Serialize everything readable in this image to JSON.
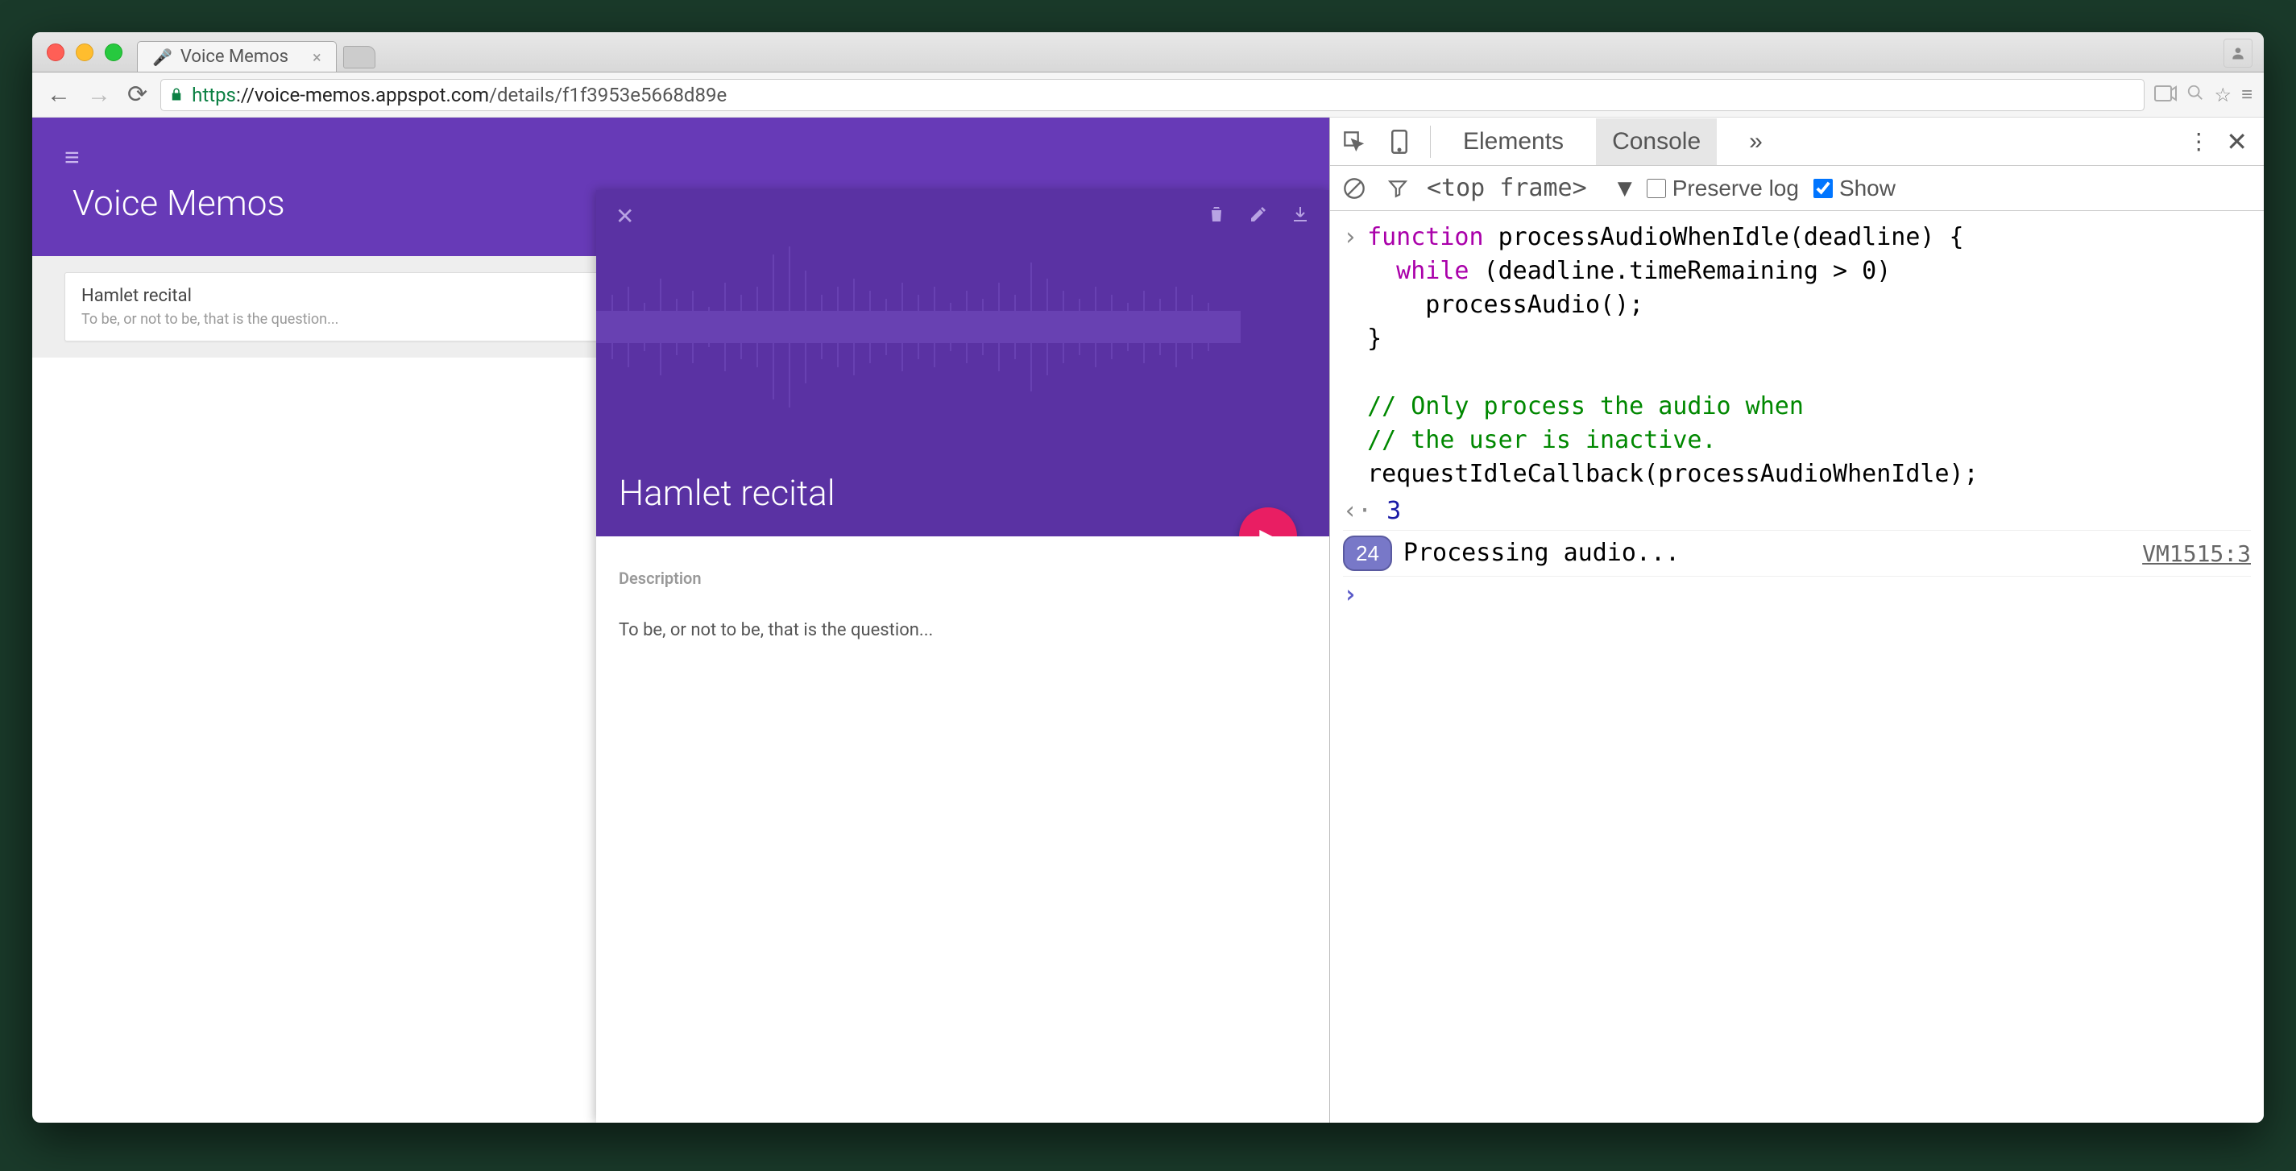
{
  "window": {
    "tab_title": "Voice Memos",
    "url_proto": "https",
    "url_domain": "://voice-memos.appspot.com",
    "url_path": "/details/f1f3953e5668d89e"
  },
  "app": {
    "title": "Voice Memos",
    "list": [
      {
        "title": "Hamlet recital",
        "subtitle": "To be, or not to be, that is the question..."
      }
    ],
    "detail": {
      "title": "Hamlet recital",
      "desc_label": "Description",
      "desc_text": "To be, or not to be, that is the question..."
    }
  },
  "devtools": {
    "tabs": {
      "elements": "Elements",
      "console": "Console",
      "more": "»"
    },
    "toolbar": {
      "frame": "<top frame>",
      "preserve": "Preserve log",
      "show": "Show"
    },
    "code": {
      "l1a": "function",
      "l1b": " processAudioWhenIdle(deadline) {",
      "l2a": "  while",
      "l2b": " (deadline.timeRemaining > 0)",
      "l3": "    processAudio();",
      "l4": "}",
      "l5": "",
      "l6": "// Only process the audio when",
      "l7": "// the user is inactive.",
      "l8": "requestIdleCallback(processAudioWhenIdle);"
    },
    "return_val": "3",
    "log": {
      "count": "24",
      "text": "Processing audio...",
      "src": "VM1515:3"
    }
  }
}
